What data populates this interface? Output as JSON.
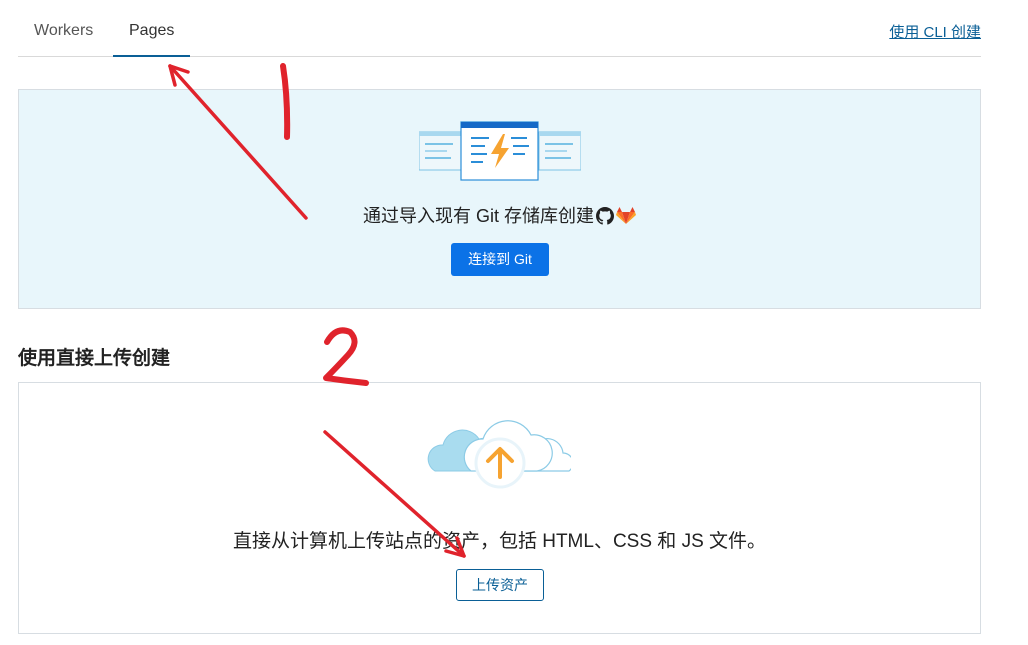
{
  "tabs": [
    {
      "label": "Workers"
    },
    {
      "label": "Pages"
    }
  ],
  "cli_link": "使用 CLI 创建",
  "git": {
    "text": "通过导入现有 Git 存储库创建",
    "button": "连接到 Git"
  },
  "direct": {
    "section_title": "使用直接上传创建",
    "text": "直接从计算机上传站点的资产，包括 HTML、CSS 和 JS 文件。",
    "button": "上传资产"
  },
  "annotations": {
    "label_1": "1",
    "label_2": "2",
    "color": "#e0232c"
  },
  "colors": {
    "primary": "#0b72e7",
    "link": "#0a5f96",
    "git_bg": "#e8f6fb",
    "upload_arrow": "#f6a331"
  }
}
